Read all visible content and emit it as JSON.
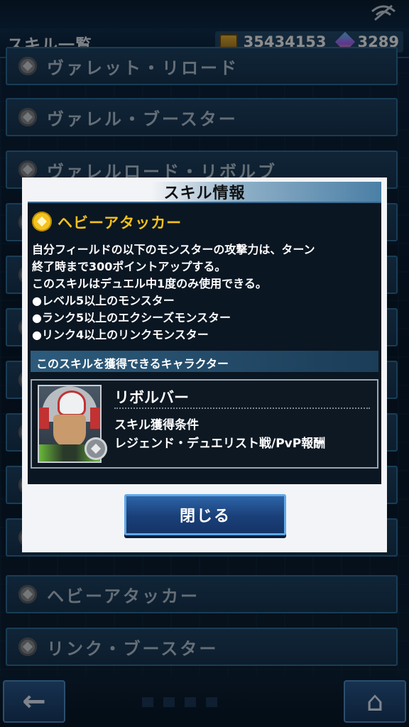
{
  "header": {
    "title": "スキル一覧",
    "gold": "35434153",
    "gems": "3289"
  },
  "skill_list": [
    {
      "name": "ヴァレット・リロード"
    },
    {
      "name": "ヴァレル・ブースター"
    },
    {
      "name": "ヴァレルロード・リボルブ"
    },
    {
      "name": ""
    },
    {
      "name": ""
    },
    {
      "name": ""
    },
    {
      "name": ""
    },
    {
      "name": ""
    },
    {
      "name": ""
    },
    {
      "name": ""
    },
    {
      "name": "ヘビーアタッカー"
    },
    {
      "name": "リンク・ブースター"
    }
  ],
  "modal": {
    "title": "スキル情報",
    "skill_name": "ヘビーアタッカー",
    "description": [
      "自分フィールドの以下のモンスターの攻撃力は、ターン",
      "終了時まで300ポイントアップする。",
      "このスキルはデュエル中1度のみ使用できる。",
      "●レベル5以上のモンスター",
      "●ランク5以上のエクシーズモンスター",
      "●リンク4以上のリンクモンスター"
    ],
    "section_label": "このスキルを獲得できるキャラクター",
    "character": {
      "name": "リボルバー",
      "condition_label": "スキル獲得条件",
      "condition_value": "レジェンド・デュエリスト戦/PvP報酬"
    },
    "close_label": "閉じる"
  },
  "nav": {
    "back": "←",
    "home": "⌂"
  }
}
